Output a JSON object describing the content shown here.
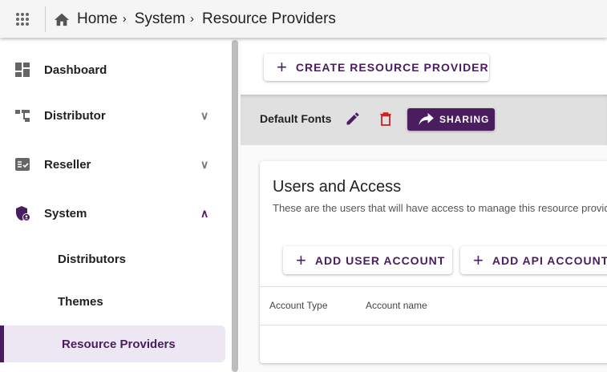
{
  "header": {
    "breadcrumb": [
      "Home",
      "System",
      "Resource Providers"
    ],
    "icons": [
      "apps-grid-icon",
      "home-icon"
    ]
  },
  "sidebar": {
    "items": [
      {
        "label": "Dashboard",
        "icon": "dashboard-icon"
      },
      {
        "label": "Distributor",
        "icon": "hierarchy-icon",
        "expanded": false
      },
      {
        "label": "Reseller",
        "icon": "checklist-icon",
        "expanded": false
      },
      {
        "label": "System",
        "icon": "admin-shield-icon",
        "expanded": true
      },
      {
        "label": "Distributors"
      },
      {
        "label": "Themes"
      },
      {
        "label": "Resource Providers",
        "selected": true
      }
    ]
  },
  "main": {
    "create_label": "CREATE RESOURCE PROVIDER",
    "provider": {
      "name": "Default Fonts",
      "sharing_label": "SHARING"
    },
    "card": {
      "title": "Users and Access",
      "subtitle": "These are the users that will have access to manage this resource provider",
      "add_user_label": "ADD USER ACCOUNT",
      "add_api_label": "ADD API ACCOUNT",
      "columns": [
        "Account Type",
        "Account name"
      ]
    }
  },
  "colors": {
    "accent": "#4a1d5f",
    "danger": "#c62828",
    "selected_bg": "#ede7f3"
  }
}
